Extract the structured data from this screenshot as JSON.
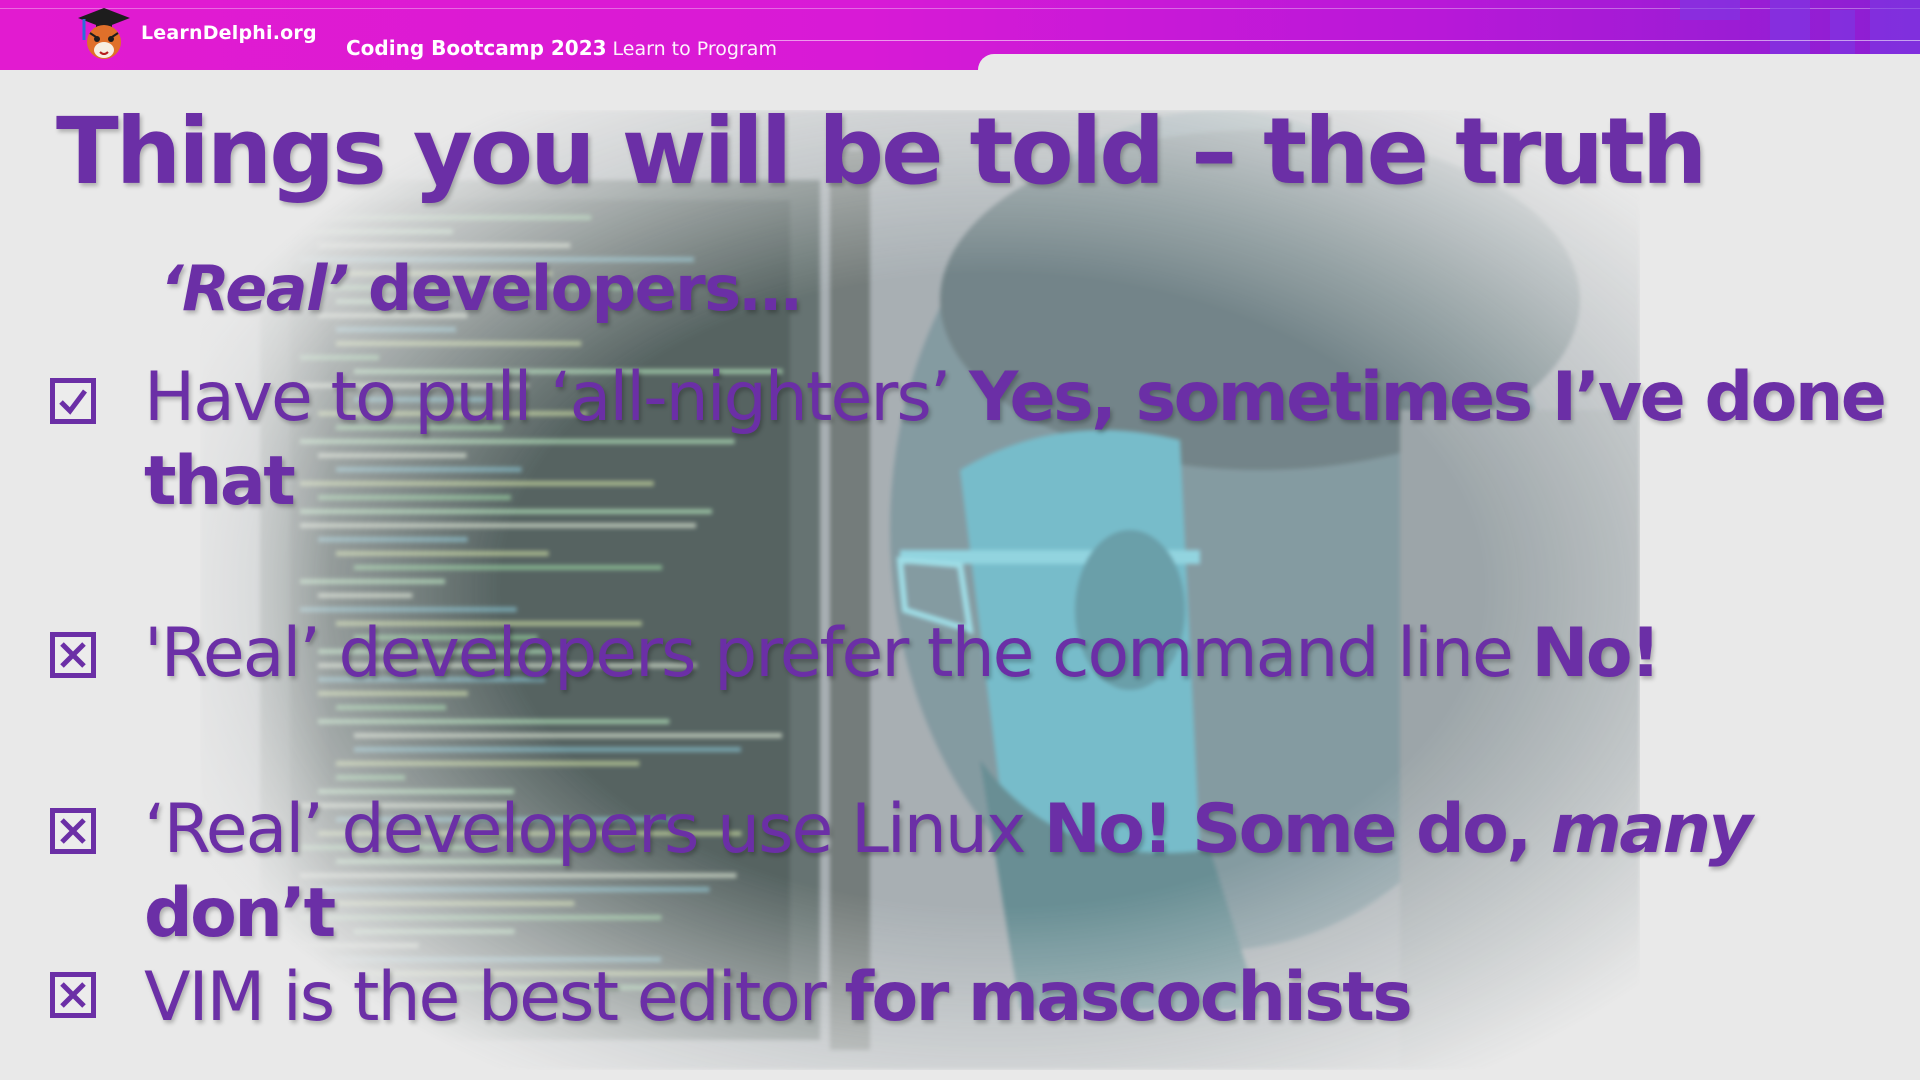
{
  "banner": {
    "site_name": "LearnDelphi.org",
    "course_bold": "Coding Bootcamp 2023",
    "course_light": "Learn to Program",
    "logo_icon": "graduation-cap-tiger-logo-icon"
  },
  "slide": {
    "title": "Things you will be told – the truth",
    "subtitle_italic": "‘Real’",
    "subtitle_rest": " developers…",
    "items": [
      {
        "status": "checked",
        "plain": "Have to pull ‘all-nighters’ ",
        "bold": "Yes, sometimes I’ve done that"
      },
      {
        "status": "crossed",
        "plain": "'Real’ developers prefer the command line ",
        "bold": "No!"
      },
      {
        "status": "crossed",
        "plain": "‘Real’ developers use Linux ",
        "bold": "No! Some do, ",
        "bold_italic": "many",
        "bold_tail": " don’t"
      },
      {
        "status": "crossed",
        "plain": "VIM is the best editor ",
        "bold": "for mascochists"
      }
    ]
  },
  "colors": {
    "accent": "#6b2fa6",
    "banner_pink": "#e21bd0",
    "banner_purple": "#8a1fd2",
    "background": "#e9e9e9"
  }
}
